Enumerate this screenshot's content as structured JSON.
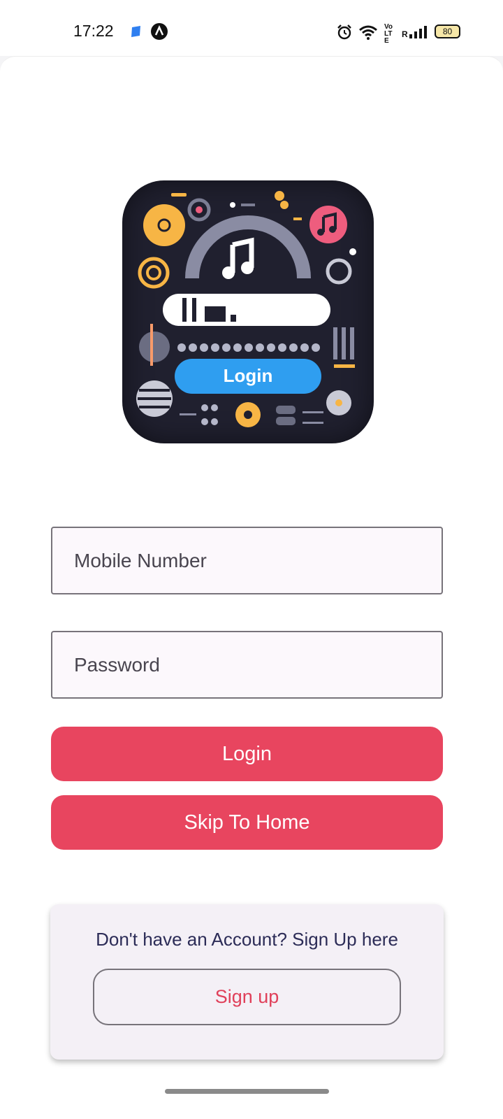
{
  "status_bar": {
    "time": "17:22",
    "battery": "80",
    "network_label": "Vo LTE",
    "roaming": "R",
    "icons": [
      "notification-app-icon",
      "navigation-app-icon",
      "alarm-icon",
      "wifi-icon",
      "signal-icon",
      "battery-icon"
    ]
  },
  "logo": {
    "button_text": "Login",
    "icon": "music-login-logo"
  },
  "form": {
    "mobile_placeholder": "Mobile Number",
    "password_placeholder": "Password",
    "login_label": "Login",
    "skip_label": "Skip To Home"
  },
  "signup": {
    "prompt": "Don't have an Account? Sign Up here",
    "button_label": "Sign up"
  },
  "colors": {
    "accent": "#e8455f",
    "field_bg": "#fcf8fc",
    "panel_bg": "#f4f0f6",
    "text_dark": "#2c2c57"
  }
}
